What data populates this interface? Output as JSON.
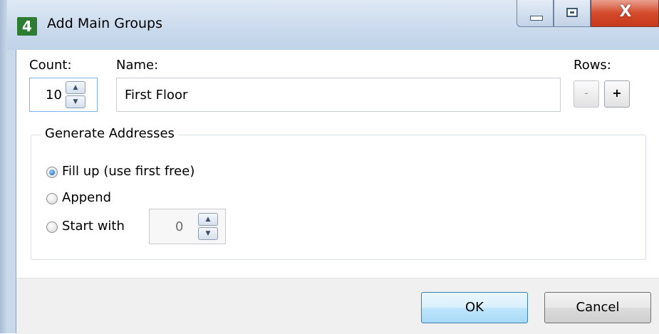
{
  "window": {
    "title": "Add Main Groups",
    "icon_glyph": "4",
    "close_glyph": "X"
  },
  "fields": {
    "count_label": "Count:",
    "count_value": "10",
    "name_label": "Name:",
    "name_value": "First Floor",
    "rows_label": "Rows:",
    "rows_minus": "-",
    "rows_plus": "+"
  },
  "generate": {
    "legend": "Generate Addresses",
    "options": [
      {
        "label": "Fill up (use first free)",
        "checked": true
      },
      {
        "label": "Append",
        "checked": false
      },
      {
        "label": "Start with",
        "checked": false
      }
    ],
    "start_value": "0"
  },
  "buttons": {
    "ok": "OK",
    "cancel": "Cancel"
  },
  "icons": {
    "spin_up": "▲",
    "spin_down": "▼"
  },
  "colors": {
    "titlebar": "#cddcee",
    "close_button": "#d44a2b",
    "focus_border": "#7eb4ea",
    "ok_button": "#bee6fd"
  }
}
